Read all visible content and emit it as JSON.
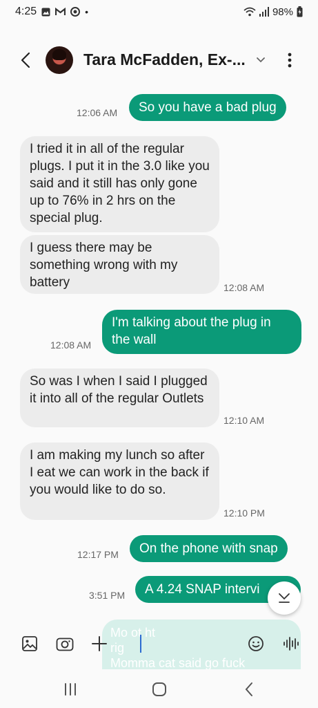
{
  "status_bar": {
    "time": "4:25",
    "battery": "98%",
    "dot": "•"
  },
  "header": {
    "contact_name": "Tara McFadden, Ex-...",
    "icons": [
      "back-arrow-icon",
      "avatar",
      "chevron-down-icon",
      "more-vert-icon"
    ]
  },
  "messages": [
    {
      "direction": "outgoing",
      "text": "So you have a bad plug",
      "time": "12:06 AM"
    },
    {
      "direction": "incoming",
      "text": "I tried it in all of the regular plugs. I put it in the 3.0 like you said and it still has only gone up to 76% in 2 hrs on the special plug.",
      "time": ""
    },
    {
      "direction": "incoming",
      "text": "I guess there may be something wrong with my battery",
      "time": "12:08 AM"
    },
    {
      "direction": "outgoing",
      "text": "I'm talking about the plug in the wall",
      "time": "12:08 AM"
    },
    {
      "direction": "incoming",
      "text": "So was I when I said I plugged it into all of the regular Outlets",
      "time": "12:10 AM"
    },
    {
      "direction": "incoming",
      "text": "I am making my lunch so after I eat we can work in the back if you would like to do so.",
      "time": "12:10 PM"
    },
    {
      "direction": "outgoing",
      "text": "On the phone with snap",
      "time": "12:17 PM"
    },
    {
      "direction": "outgoing",
      "text": "A 4.24 SNAP intervi",
      "time": "3:51 PM"
    }
  ],
  "draft": {
    "line1": "Mo              ot              ht",
    "line2": "rig",
    "line3": "Momma cat said go fuck"
  },
  "composer": {
    "icons": [
      "gallery-icon",
      "camera-icon",
      "add-icon",
      "emoji-icon",
      "voice-icon"
    ]
  },
  "nav": {
    "icons": [
      "recent-apps-icon",
      "home-icon",
      "back-icon"
    ]
  },
  "colors": {
    "outgoing_bubble": "#0b9a78",
    "incoming_bubble": "#ececec",
    "background": "#fafafa"
  }
}
